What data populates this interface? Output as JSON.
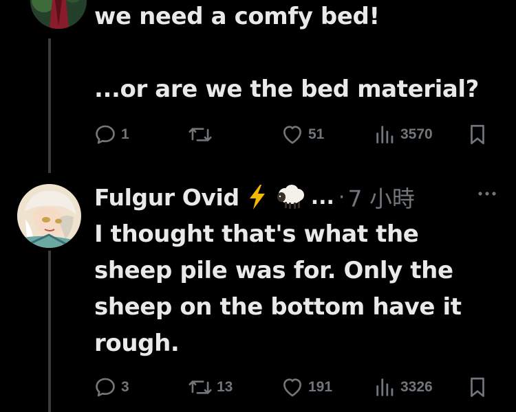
{
  "post_top": {
    "text": "we need a comfy bed!\n\n...or are we the bed material?",
    "actions": {
      "reply_count": "1",
      "repost_count": "",
      "like_count": "51",
      "view_count": "3570"
    }
  },
  "post_reply": {
    "author_name": "Fulgur Ovid",
    "name_ellipsis": "...",
    "separator": "·",
    "time": "7 小時",
    "text": "I thought that's what the\nsheep pile was for. Only the\nsheep on the bottom have it\nrough.",
    "actions": {
      "reply_count": "3",
      "repost_count": "13",
      "like_count": "191",
      "view_count": "3326"
    }
  },
  "icons": {
    "reply": "reply-icon",
    "repost": "repost-icon",
    "like": "heart-icon",
    "views": "views-icon",
    "bookmark": "bookmark-icon",
    "more": "more-options-icon",
    "lightning": "lightning-emoji",
    "sheep": "sheep-emoji"
  },
  "colors": {
    "background": "#000000",
    "text": "#e7e9ea",
    "muted": "#71767b",
    "thread_line": "#3a3d40",
    "lightning": "#f5b800"
  }
}
